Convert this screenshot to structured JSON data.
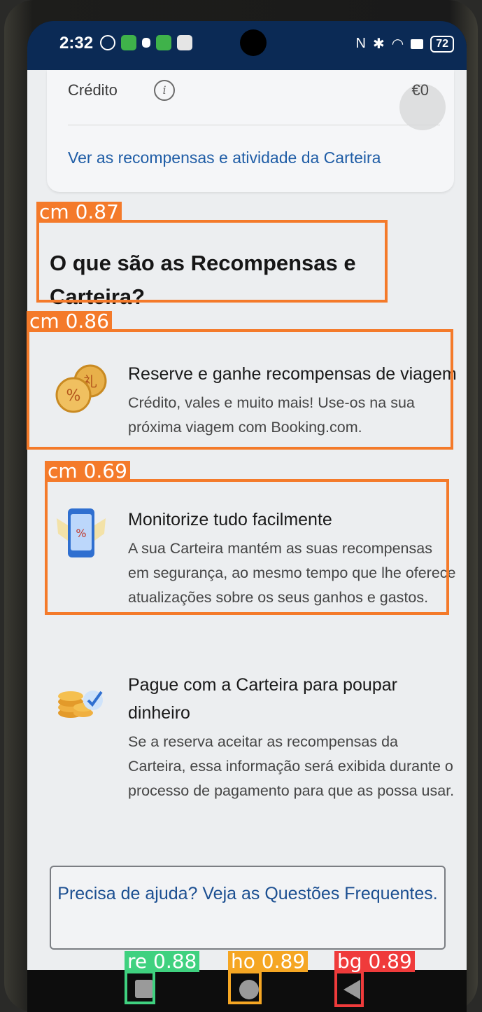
{
  "status_bar": {
    "time": "2:32",
    "battery": "72"
  },
  "wallet_card": {
    "credit_label": "Crédito",
    "credit_value": "€0",
    "wallet_link": "Ver as recompensas e atividade da Carteira"
  },
  "section": {
    "title": "O que são as Recompensas e Carteira?"
  },
  "features": [
    {
      "title": "Reserve e ganhe recompensas de viagem",
      "description": "Crédito, vales e muito mais! Use-os na sua próxima viagem com Booking.com.",
      "icon": "coins-icon"
    },
    {
      "title": "Monitorize tudo facilmente",
      "description": "A sua Carteira mantém as suas recompensas em segurança, ao mesmo tempo que lhe oferece atualizações sobre os seus ganhos e gastos.",
      "icon": "phone-wallet-icon"
    },
    {
      "title": "Pague com a Carteira para poupar dinheiro",
      "description": "Se a reserva aceitar as recompensas da Carteira, essa informação será exibida durante o processo de pagamento para que as possa usar.",
      "icon": "coin-stack-check-icon"
    }
  ],
  "help": {
    "text": "Precisa de ajuda? Veja as Questões Frequentes."
  },
  "detections": [
    {
      "label": "cm 0.87",
      "color": "#f47a2a"
    },
    {
      "label": "cm 0.86",
      "color": "#f47a2a"
    },
    {
      "label": "cm 0.69",
      "color": "#f47a2a"
    },
    {
      "label": "re 0.88",
      "color": "#3fd17f"
    },
    {
      "label": "ho 0.89",
      "color": "#f5a623"
    },
    {
      "label": "bg 0.89",
      "color": "#ef3b3b"
    }
  ]
}
